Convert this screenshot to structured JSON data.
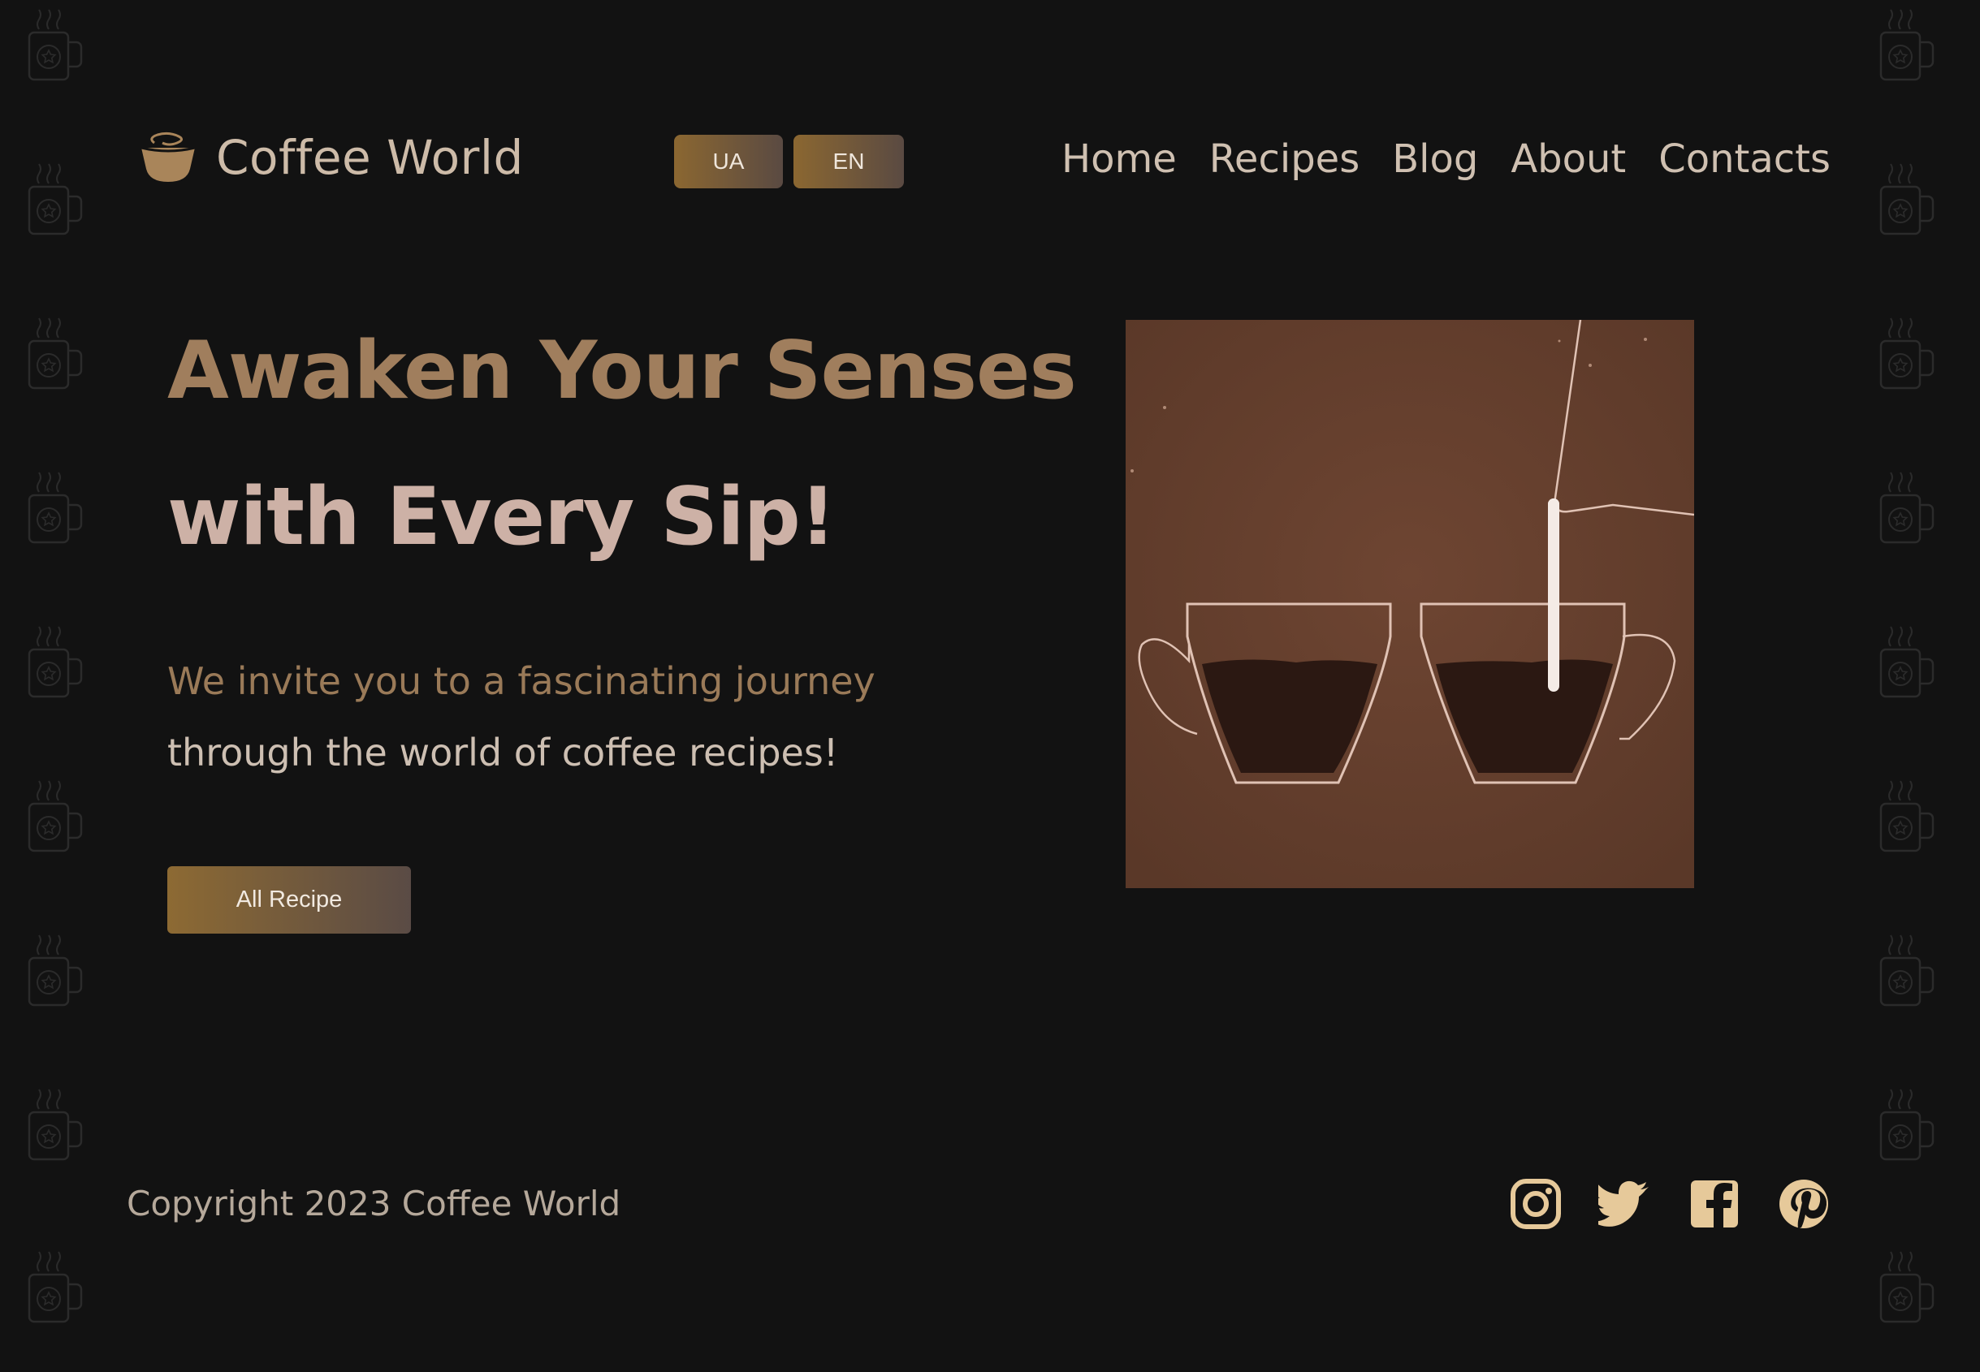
{
  "brand": {
    "name": "Coffee World"
  },
  "languages": [
    {
      "label": "UA"
    },
    {
      "label": "EN"
    }
  ],
  "nav": [
    {
      "label": "Home"
    },
    {
      "label": "Recipes"
    },
    {
      "label": "Blog"
    },
    {
      "label": "About"
    },
    {
      "label": "Contacts"
    }
  ],
  "hero": {
    "title_line1": "Awaken Your Senses",
    "title_line2": "with Every Sip!",
    "text_line1": "We invite you to a fascinating journey",
    "text_line2": "through the world of coffee recipes!",
    "button": "All Recipe"
  },
  "footer": {
    "copyright": "Copyright 2023 Coffee World",
    "social_icons": [
      "instagram-icon",
      "twitter-icon",
      "facebook-icon",
      "pinterest-icon"
    ]
  },
  "colors": {
    "background": "#121212",
    "accent_gold": "#a07e5d",
    "title_pink": "#cdb1a6",
    "image_brown": "#633f2e",
    "social_icon": "#e6c99a"
  }
}
